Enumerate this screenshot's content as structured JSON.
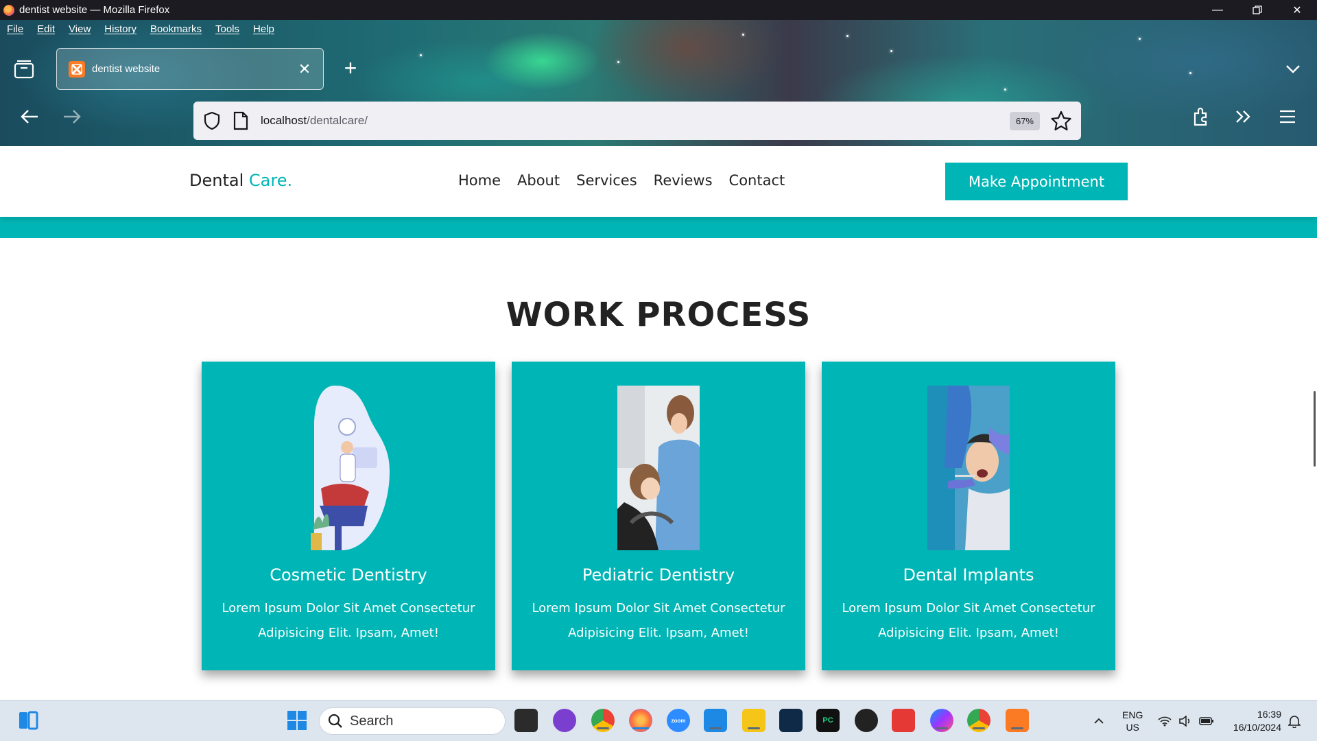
{
  "window": {
    "title": "dentist website — Mozilla Firefox"
  },
  "menubar": [
    "File",
    "Edit",
    "View",
    "History",
    "Bookmarks",
    "Tools",
    "Help"
  ],
  "tab": {
    "title": "dentist website"
  },
  "urlbar": {
    "host": "localhost",
    "path": "/dentalcare/",
    "zoom": "67%"
  },
  "site": {
    "logo_main": "Dental",
    "logo_accent": "Care.",
    "nav": [
      "Home",
      "About",
      "Services",
      "Reviews",
      "Contact"
    ],
    "cta": "Make Appointment",
    "accent_color": "#00b5b5"
  },
  "section": {
    "title": "WORK PROCESS",
    "cards": [
      {
        "title": "Cosmetic Dentistry",
        "desc": "Lorem Ipsum Dolor Sit Amet Consectetur Adipisicing Elit. Ipsam, Amet!"
      },
      {
        "title": "Pediatric Dentistry",
        "desc": "Lorem Ipsum Dolor Sit Amet Consectetur Adipisicing Elit. Ipsam, Amet!"
      },
      {
        "title": "Dental Implants",
        "desc": "Lorem Ipsum Dolor Sit Amet Consectetur Adipisicing Elit. Ipsam, Amet!"
      }
    ]
  },
  "taskbar": {
    "search_placeholder": "Search",
    "lang": "ENG",
    "region": "US",
    "time": "16:39",
    "date": "16/10/2024"
  }
}
